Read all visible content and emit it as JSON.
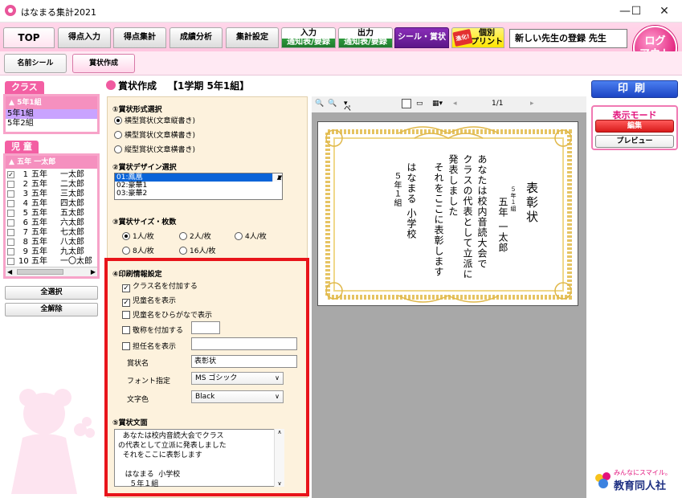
{
  "window": {
    "title": "はなまる集計2021",
    "minimize": "—",
    "maximize": "☐",
    "close": "✕"
  },
  "tabs": {
    "top": "TOP",
    "items": [
      "得点入力",
      "得点集計",
      "成績分析",
      "集計設定"
    ],
    "nyuryoku": {
      "l1": "入力",
      "l2": "通知表/要録"
    },
    "shutsuryoku": {
      "l1": "出力",
      "l2": "通知表/要録"
    },
    "seal": "シール・賞状",
    "print": {
      "badge": "進化!",
      "l1": "個別",
      "l2": "プリント"
    },
    "teacher": "新しい先生の登録  先生",
    "logout": {
      "l1": "ログ",
      "l2": "アウト"
    }
  },
  "subtabs": {
    "name_seal": "名前シール",
    "award": "賞状作成"
  },
  "left": {
    "class_title": "クラス",
    "class_header": "5年1組",
    "classes": [
      "5年1組",
      "5年2組"
    ],
    "student_title": "児 童",
    "student_header": "五年  一太郎",
    "students": [
      {
        "no": "1",
        "grade": "五年",
        "name": "一太郎",
        "checked": true
      },
      {
        "no": "2",
        "grade": "五年",
        "name": "二太郎",
        "checked": false
      },
      {
        "no": "3",
        "grade": "五年",
        "name": "三太郎",
        "checked": false
      },
      {
        "no": "4",
        "grade": "五年",
        "name": "四太郎",
        "checked": false
      },
      {
        "no": "5",
        "grade": "五年",
        "name": "五太郎",
        "checked": false
      },
      {
        "no": "6",
        "grade": "五年",
        "name": "六太郎",
        "checked": false
      },
      {
        "no": "7",
        "grade": "五年",
        "name": "七太郎",
        "checked": false
      },
      {
        "no": "8",
        "grade": "五年",
        "name": "八太郎",
        "checked": false
      },
      {
        "no": "9",
        "grade": "五年",
        "name": "九太郎",
        "checked": false
      },
      {
        "no": "10",
        "grade": "五年",
        "name": "一〇太郎",
        "checked": false
      }
    ],
    "select_all": "全選択",
    "deselect_all": "全解除"
  },
  "center": {
    "heading": "賞状作成",
    "term": "【1学期  5年1組】",
    "sec1": "①賞状形式選択",
    "format_options": [
      "横型賞状(文章縦書き)",
      "横型賞状(文章横書き)",
      "縦型賞状(文章横書き)"
    ],
    "sec2": "②賞状デザイン選択",
    "designs": [
      "01:鳳凰",
      "02:豪華1",
      "03:豪華2"
    ],
    "sec3": "③賞状サイズ・枚数",
    "sizes": [
      "1人/枚",
      "2人/枚",
      "4人/枚",
      "8人/枚",
      "16人/枚"
    ],
    "sec4": "④印刷情報設定",
    "chk_class": "クラス名を付加する",
    "chk_student": "児童名を表示",
    "chk_hiragana": "児童名をひらがなで表示",
    "chk_honorific": "敬称を付加する",
    "chk_teacher": "担任名を表示",
    "award_label": "賞状名",
    "award_value": "表彰状",
    "font_label": "フォント指定",
    "font_value": "MS ゴシック",
    "color_label": "文字色",
    "color_value": "Black",
    "sec5": "⑤賞状文面",
    "body_text": "  あなたは校内音読大会でクラス\nの代表として立派に発表しました\n  それをここに表彰します\n\n   はなまる  小学校\n     ５年１組"
  },
  "preview": {
    "page_label": "ページ全体",
    "page_count": "1/1",
    "title": "表彰状",
    "class_small": "５年１組",
    "name_line": "五年  一太郎",
    "lines": [
      "あなたは校内音読大会で",
      "クラスの代表として立派に",
      "発表しました",
      "それをここに表彰します"
    ],
    "school": "はなまる  小学校",
    "class_bottom": "５年１組"
  },
  "right": {
    "print": "印刷",
    "mode_title": "表示モード",
    "edit": "編集",
    "preview": "プレビュー",
    "logo_small": "みんなにスマイル。",
    "logo_big": "教育同人社"
  },
  "colors": {
    "brand_pink": "#f35fa3",
    "active_tab": "#6b1d96",
    "highlight_red": "#e8141a",
    "print_blue": "#1c45c4"
  }
}
